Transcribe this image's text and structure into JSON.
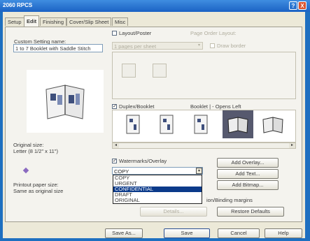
{
  "window": {
    "title": "2060 RPCS",
    "help_label": "?",
    "close_label": "X"
  },
  "tabs": [
    {
      "label": "Setup"
    },
    {
      "label": "Edit"
    },
    {
      "label": "Finishing"
    },
    {
      "label": "Cover/Slip Sheet"
    },
    {
      "label": "Misc"
    }
  ],
  "left": {
    "custom_setting_label": "Custom Setting name:",
    "custom_setting_value": "1 to 7 Booklet with Saddle Stitch",
    "original_size_label": "Original size:",
    "original_size_value": "Letter (8 1/2\" x 11\")",
    "printout_size_label": "Printout paper size:",
    "printout_size_value": "Same as original size"
  },
  "layout": {
    "checkbox_label": "Layout/Poster",
    "page_order_label": "Page Order Layout:",
    "select_value": "1 pages per sheet",
    "draw_border_label": "Draw border"
  },
  "booklet": {
    "checkbox_label": "Duplex/Booklet",
    "caption": "Booklet | - Opens Left"
  },
  "watermark": {
    "checkbox_label": "Watermarks/Overlay",
    "selected": "COPY",
    "options": [
      "COPY",
      "URGENT",
      "CONFIDENTIAL",
      "DRAFT",
      "ORIGINAL"
    ],
    "selected_index": 2
  },
  "buttons": {
    "add_overlay": "Add Overlay...",
    "add_text": "Add Text...",
    "add_bitmap": "Add Bitmap...",
    "binding_label": "ion/Binding margins",
    "details": "Details...",
    "restore_defaults": "Restore Defaults",
    "save_as": "Save As...",
    "save": "Save",
    "cancel": "Cancel",
    "help": "Help"
  }
}
